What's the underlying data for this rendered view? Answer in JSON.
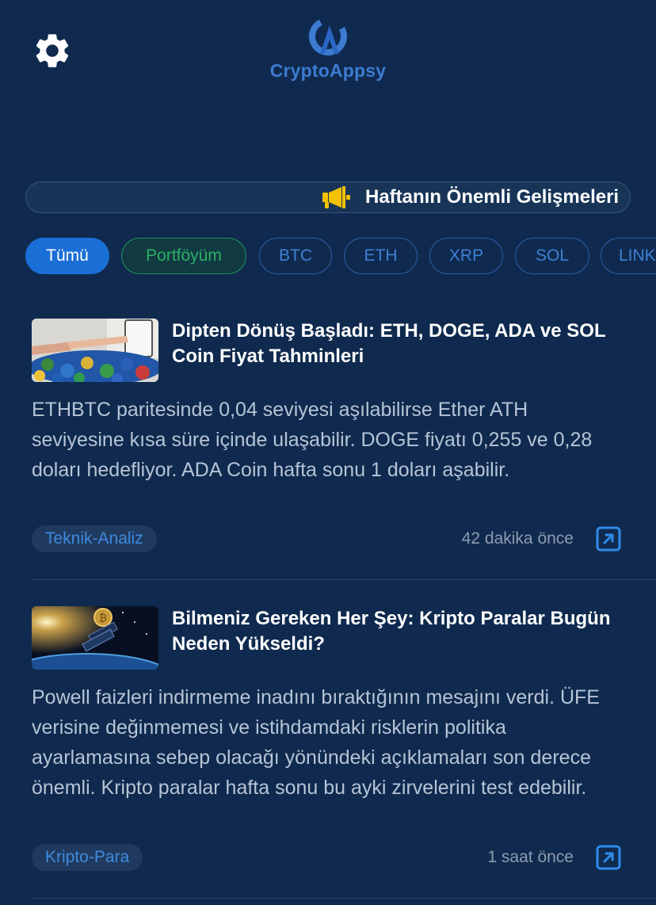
{
  "header": {
    "brand": "CryptoAppsy",
    "settings_icon": "gear-icon"
  },
  "ticker": {
    "text": "Haftanın Önemli Gelişmeleri",
    "icon": "megaphone-icon"
  },
  "filters": [
    "Tümü",
    "Portföyüm",
    "BTC",
    "ETH",
    "XRP",
    "SOL",
    "LINK"
  ],
  "articles": [
    {
      "title": "Dipten Dönüş Başladı: ETH, DOGE, ADA ve SOL Coin Fiyat Tahminleri",
      "summary": "ETHBTC paritesinde 0,04 seviyesi aşılabilirse Ether ATH seviyesine kısa süre içinde ulaşabilir. DOGE fiyatı 0,255 ve 0,28 doları hedefliyor. ADA Coin hafta sonu 1 doları aşabilir.",
      "tag": "Teknik-Analiz",
      "time": "42 dakika önce"
    },
    {
      "title": "Bilmeniz Gereken Her Şey: Kripto Paralar Bugün Neden Yükseldi?",
      "summary": "Powell faizleri indirmeme inadını bıraktığının mesajını verdi. ÜFE verisine değinmemesi ve istihdamdaki risklerin politika ayarlamasına sebep olacağı yönündeki açıklamaları son derece önemli. Kripto paralar hafta sonu bu ayki zirvelerini test edebilir.",
      "tag": "Kripto-Para",
      "time": "1 saat önce"
    }
  ],
  "colors": {
    "background": "#0f2a4e",
    "accent": "#1a6fd6",
    "portfolio_green": "#2bb064",
    "megaphone": "#f2c200"
  }
}
